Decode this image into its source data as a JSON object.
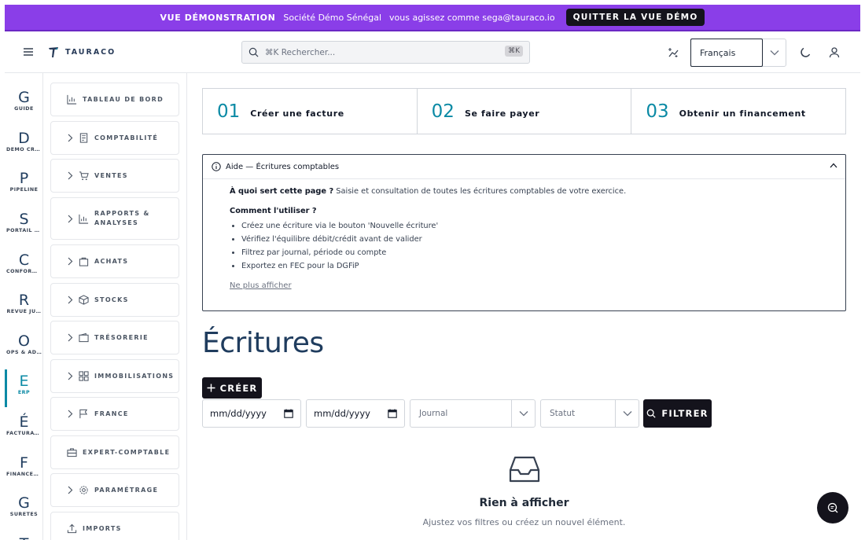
{
  "demo_banner": {
    "label": "VUE DÉMONSTRATION",
    "company": "Société Démo Sénégal",
    "acting_as": "vous agissez comme sega@tauraco.io",
    "quit_label": "QUITTER LA VUE DÉMO",
    "color": "#8a3ee8"
  },
  "topbar": {
    "brand": "TAURACO",
    "search_placeholder": "⌘K Rechercher...",
    "search_shortcut": "⌘K",
    "language": "Français"
  },
  "rail": [
    {
      "letter": "G",
      "caption": "GUIDE"
    },
    {
      "letter": "D",
      "caption": "DÉMO CRUD"
    },
    {
      "letter": "P",
      "caption": "PIPELINE"
    },
    {
      "letter": "S",
      "caption": "PORTAIL V…"
    },
    {
      "letter": "C",
      "caption": "CONFORM…"
    },
    {
      "letter": "R",
      "caption": "REVUE JU…"
    },
    {
      "letter": "O",
      "caption": "OPS & AD…"
    },
    {
      "letter": "E",
      "caption": "ERP",
      "active": true
    },
    {
      "letter": "É",
      "caption": "FACTURAT…"
    },
    {
      "letter": "F",
      "caption": "FINANCEM…"
    },
    {
      "letter": "G",
      "caption": "SÛRETÉS"
    },
    {
      "letter": "T",
      "caption": ""
    }
  ],
  "sidenav": [
    {
      "label": "TABLEAU DE BORD",
      "icon": "chart-icon"
    },
    {
      "label": "COMPTABILITÉ",
      "icon": "document-icon"
    },
    {
      "label": "VENTES",
      "icon": "cart-icon"
    },
    {
      "label": "RAPPORTS &",
      "label2": "ANALYSES",
      "icon": "bar-chart-icon"
    },
    {
      "label": "ACHATS",
      "icon": "bag-icon"
    },
    {
      "label": "STOCKS",
      "icon": "box-icon"
    },
    {
      "label": "TRÉSORERIE",
      "icon": "wallet-icon"
    },
    {
      "label": "IMMOBILISATIONS",
      "icon": "grid-icon"
    },
    {
      "label": "FRANCE",
      "icon": "flag-icon"
    },
    {
      "label": "EXPERT-COMPTABLE",
      "icon": "briefcase-icon"
    },
    {
      "label": "PARAMÉTRAGE",
      "icon": "gear-icon"
    },
    {
      "label": "IMPORTS",
      "icon": "upload-icon"
    }
  ],
  "steps": [
    {
      "num": "01",
      "text": "Créer une facture"
    },
    {
      "num": "02",
      "text": "Se faire payer"
    },
    {
      "num": "03",
      "text": "Obtenir un financement"
    }
  ],
  "help": {
    "title": "Aide — Écritures comptables",
    "purpose_q": "À quoi sert cette page ?",
    "purpose_a": " Saisie et consultation de toutes les écritures comptables de votre exercice.",
    "howto": "Comment l'utiliser ?",
    "tips": [
      "Créez une écriture via le bouton 'Nouvelle écriture'",
      "Vérifiez l'équilibre débit/crédit avant de valider",
      "Filtrez par journal, période ou compte",
      "Exportez en FEC pour la DGFiP"
    ],
    "dismiss": "Ne plus afficher"
  },
  "page": {
    "title": "Écritures",
    "create_label": "CRÉER"
  },
  "filters": {
    "date_from": "mm/dd/yyyy",
    "date_to": "mm/dd/yyyy",
    "journal": "Journal",
    "status": "Statut",
    "filter_label": "FILTRER"
  },
  "empty": {
    "title": "Rien à afficher",
    "subtitle": "Ajustez vos filtres ou créez un nouvel élément."
  }
}
